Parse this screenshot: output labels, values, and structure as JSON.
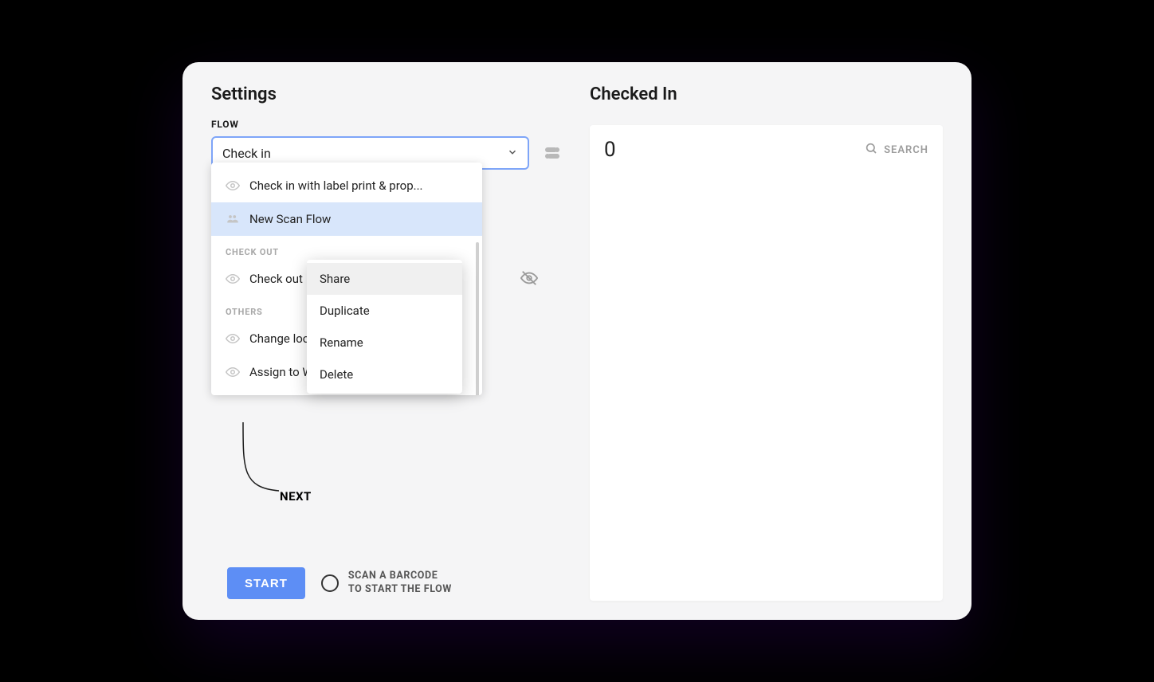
{
  "left": {
    "title": "Settings",
    "flow_label": "FLOW",
    "select_value": "Check in",
    "dropdown": {
      "items_top": [
        {
          "label": "Check in with label print & prop..."
        }
      ],
      "highlighted": {
        "label": "New Scan Flow"
      },
      "section_checkout": "CHECK OUT",
      "checkout_item": "Check out",
      "section_others": "OTHERS",
      "others_items": [
        {
          "label": "Change loc"
        },
        {
          "label": "Assign to W"
        }
      ]
    },
    "context_menu": {
      "share": "Share",
      "duplicate": "Duplicate",
      "rename": "Rename",
      "delete": "Delete"
    },
    "next_label": "NEXT",
    "start_button": "START",
    "scan_hint_line1": "SCAN A BARCODE",
    "scan_hint_line2": "TO START THE FLOW"
  },
  "right": {
    "title": "Checked In",
    "count": "0",
    "search_label": "SEARCH"
  }
}
